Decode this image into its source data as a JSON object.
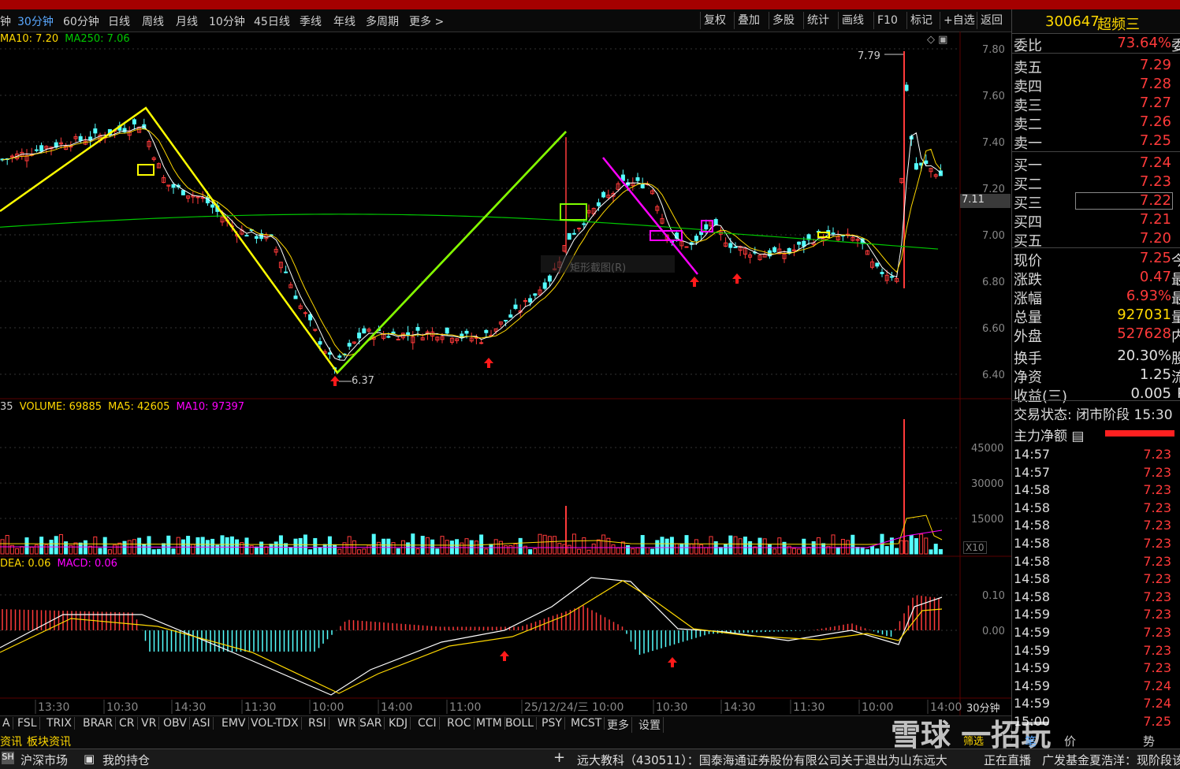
{
  "periods": [
    "钟",
    "30分钟",
    "60分钟",
    "日线",
    "周线",
    "月线",
    "10分钟",
    "45日线",
    "季线",
    "年线",
    "多周期",
    "更多 >"
  ],
  "active_period": "30分钟",
  "tools": [
    "复权",
    "叠加",
    "多股",
    "统计",
    "画线",
    "F10",
    "标记",
    "+自选",
    "返回"
  ],
  "ma_legend": {
    "ma10_label": "MA10: 7.20",
    "ma250_label": "MA250: 7.06"
  },
  "price_axis": [
    "7.80",
    "7.60",
    "7.40",
    "7.20",
    "7.00",
    "6.80",
    "6.60",
    "6.40"
  ],
  "price_current_tag": "7.11",
  "annotations": {
    "high": "7.79",
    "low": "6.37",
    "watermark_text": "矩形截图(R)"
  },
  "volume_legend": {
    "prefix": "35",
    "volume": "VOLUME: 69885",
    "ma5": "MA5: 42605",
    "ma10": "MA10: 97397"
  },
  "volume_axis": [
    "45000",
    "30000",
    "15000"
  ],
  "volume_unit": "X10",
  "macd_legend": {
    "dea": "DEA: 0.06",
    "macd": "MACD: 0.06"
  },
  "macd_axis": [
    "0.10",
    "0.00"
  ],
  "time_axis": [
    "13:30",
    "10:30",
    "14:30",
    "11:30",
    "10:00",
    "14:00",
    "11:00",
    "25/12/24/三 10:00",
    "10:30",
    "14:30",
    "11:30",
    "10:00",
    "14:00"
  ],
  "time_axis_period": "30分钟",
  "stock": {
    "code": "300647",
    "name": "超频三"
  },
  "order_book": {
    "ratio": {
      "label": "委比",
      "value": "73.64%",
      "tail": "委"
    },
    "sells": [
      {
        "label": "卖五",
        "price": "7.29"
      },
      {
        "label": "卖四",
        "price": "7.28"
      },
      {
        "label": "卖三",
        "price": "7.27"
      },
      {
        "label": "卖二",
        "price": "7.26"
      },
      {
        "label": "卖一",
        "price": "7.25"
      }
    ],
    "buys": [
      {
        "label": "买一",
        "price": "7.24"
      },
      {
        "label": "买二",
        "price": "7.23"
      },
      {
        "label": "买三",
        "price": "7.22"
      },
      {
        "label": "买四",
        "price": "7.21"
      },
      {
        "label": "买五",
        "price": "7.20"
      }
    ]
  },
  "quote": [
    {
      "label": "现价",
      "value": "7.25",
      "tail": "今",
      "color": "#ff3a3a"
    },
    {
      "label": "涨跌",
      "value": "0.47",
      "tail": "最",
      "color": "#ff3a3a"
    },
    {
      "label": "涨幅",
      "value": "6.93%",
      "tail": "最",
      "color": "#ff3a3a"
    },
    {
      "label": "总量",
      "value": "927031",
      "tail": "量",
      "color": "#ffd800"
    },
    {
      "label": "外盘",
      "value": "527628",
      "tail": "内",
      "color": "#ff3a3a"
    },
    {
      "label": "换手",
      "value": "20.30%",
      "tail": "股",
      "color": "#e0e0e0"
    },
    {
      "label": "净资",
      "value": "1.25",
      "tail": "流",
      "color": "#e0e0e0"
    },
    {
      "label": "收益(三)",
      "value": "0.005",
      "tail": "P",
      "color": "#e0e0e0"
    }
  ],
  "trade_status": "交易状态: 闭市阶段 15:30",
  "main_force": "主力净额",
  "ticks": [
    {
      "time": "14:57",
      "price": "7.23"
    },
    {
      "time": "14:57",
      "price": "7.23"
    },
    {
      "time": "14:58",
      "price": "7.23"
    },
    {
      "time": "14:58",
      "price": "7.23"
    },
    {
      "time": "14:58",
      "price": "7.23"
    },
    {
      "time": "14:58",
      "price": "7.23"
    },
    {
      "time": "14:58",
      "price": "7.23"
    },
    {
      "time": "14:58",
      "price": "7.23"
    },
    {
      "time": "14:58",
      "price": "7.23"
    },
    {
      "time": "14:59",
      "price": "7.23"
    },
    {
      "time": "14:59",
      "price": "7.23"
    },
    {
      "time": "14:59",
      "price": "7.23"
    },
    {
      "time": "14:59",
      "price": "7.23"
    },
    {
      "time": "14:59",
      "price": "7.24"
    },
    {
      "time": "14:59",
      "price": "7.24"
    },
    {
      "time": "15:00",
      "price": "7.25"
    }
  ],
  "indicators": [
    "A",
    "FSL",
    "TRIX",
    "BRAR",
    "CR",
    "VR",
    "OBV",
    "ASI",
    "EMV",
    "VOL-TDX",
    "RSI",
    "WR",
    "SAR",
    "KDJ",
    "CCI",
    "ROC",
    "MTM",
    "BOLL",
    "PSY",
    "MCST",
    "更多",
    "设置"
  ],
  "info_tabs": [
    "资讯",
    "板块资讯"
  ],
  "status": {
    "market": "沪深市场",
    "holdings": "我的持仓",
    "news": "远大教科（430511）：国泰海通证券股份有限公司关于退出为山东远大",
    "live": "正在直播",
    "live_text": "广发基金夏浩洋：现阶段该"
  },
  "right_bottom": {
    "pen": "笔",
    "price": "价",
    "trend": "势",
    "select": "筛选"
  },
  "xueqiu_logo": "雪球 一招玩",
  "colors": {
    "up": "#ff3a3a",
    "down": "#54ffff",
    "ma_white": "#ffffff",
    "ma_yellow": "#ffd800",
    "ma_green": "#00c800",
    "magenta": "#ff00ff"
  }
}
